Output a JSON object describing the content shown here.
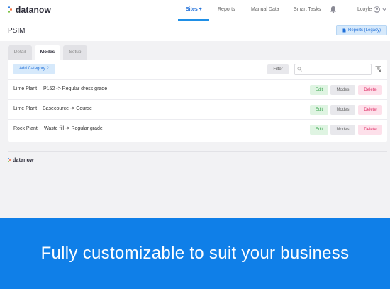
{
  "brand": {
    "name": "datanow"
  },
  "nav": {
    "items": [
      {
        "label": "Sites +",
        "active": true
      },
      {
        "label": "Reports",
        "active": false
      },
      {
        "label": "Manual Data",
        "active": false
      },
      {
        "label": "Smart Tasks",
        "active": false
      }
    ],
    "user": "Lcoyle"
  },
  "page": {
    "title": "PSIM",
    "legacy_button": "Reports (Legacy)"
  },
  "tabs": [
    {
      "label": "Detail",
      "active": false
    },
    {
      "label": "Modes",
      "active": true
    },
    {
      "label": "Setup",
      "active": false
    }
  ],
  "toolbar": {
    "add_label": "Add Category 2",
    "filter_label": "Filter",
    "search_value": "",
    "search_placeholder": ""
  },
  "rows": [
    {
      "plant": "Lime Plant",
      "mode": "P152 -> Regular dress grade",
      "edit": "Edit",
      "modes": "Modes",
      "delete": "Delete"
    },
    {
      "plant": "Lime Plant",
      "mode": "Basecource -> Course",
      "edit": "Edit",
      "modes": "Modes",
      "delete": "Delete"
    },
    {
      "plant": "Rock Plant",
      "mode": "Waste fill -> Regular grade",
      "edit": "Edit",
      "modes": "Modes",
      "delete": "Delete"
    }
  ],
  "footer": {
    "brand": "datanow"
  },
  "banner": {
    "text": "Fully customizable to suit your business"
  },
  "colors": {
    "accent": "#1f8fe6",
    "banner": "#0f7fe8",
    "edit": "#3aa64f",
    "delete": "#e0356b"
  },
  "icons": [
    "bell-icon",
    "user-avatar-icon",
    "chevron-down-icon",
    "document-icon",
    "search-icon",
    "clear-filter-icon"
  ]
}
